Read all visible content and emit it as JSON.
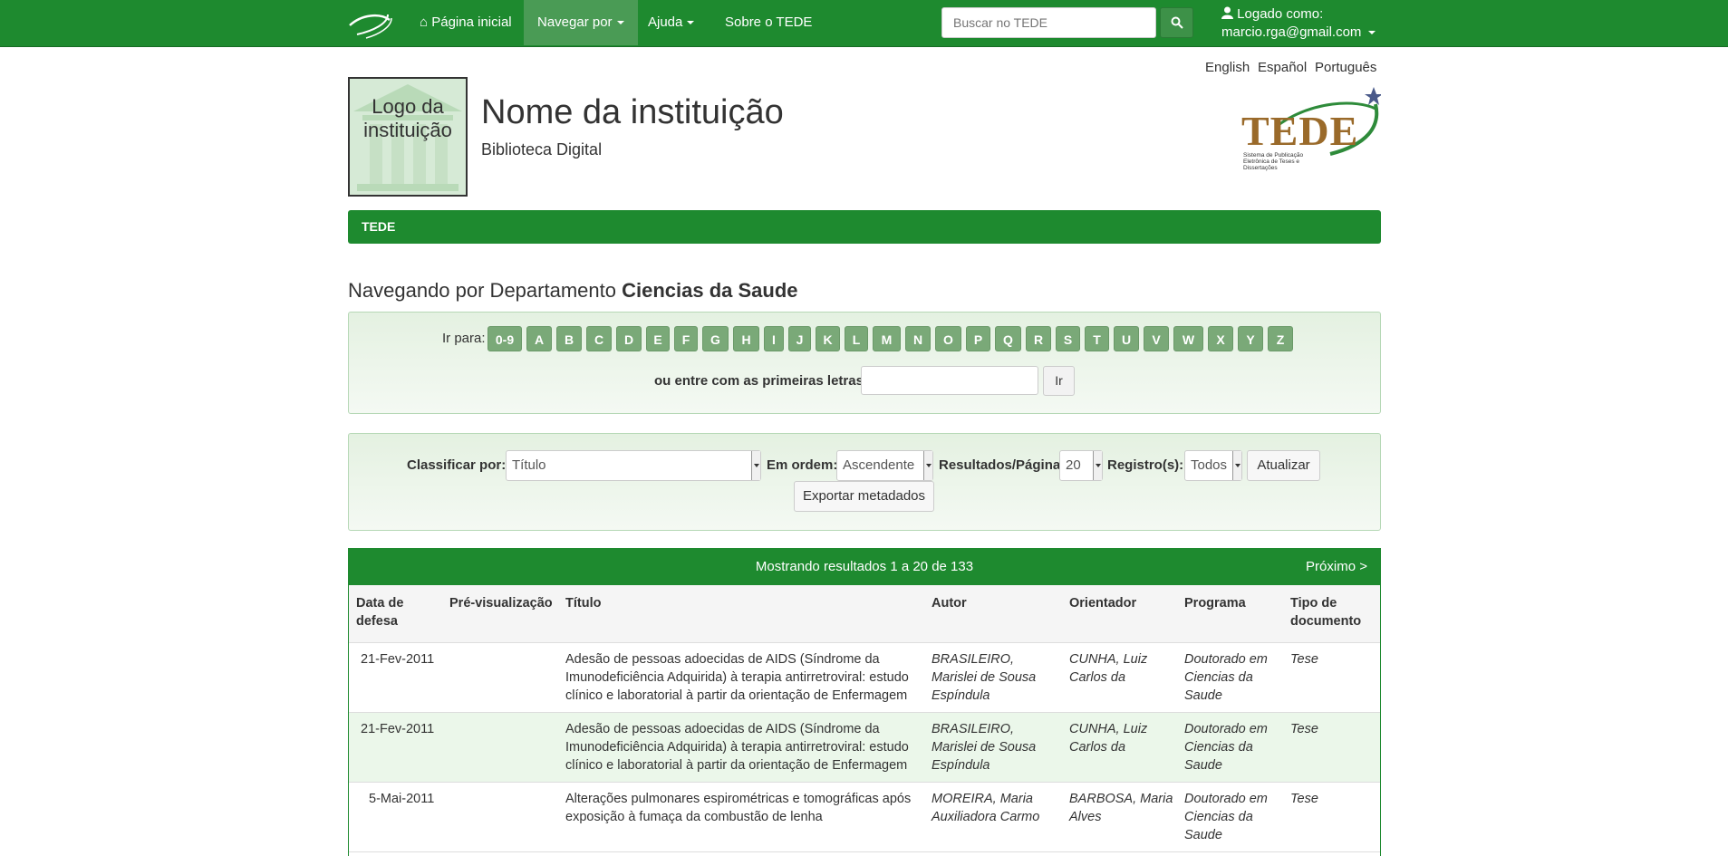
{
  "navbar": {
    "home": "Página inicial",
    "browse": "Navegar por",
    "help": "Ajuda",
    "about": "Sobre o TEDE",
    "search_placeholder": "Buscar no TEDE",
    "logged_as": "Logado como:",
    "user_email": "marcio.rga@gmail.com"
  },
  "languages": [
    "English",
    "Español",
    "Português"
  ],
  "header": {
    "logo_text": "Logo da instituição",
    "institution_name": "Nome da instituição",
    "institution_sub": "Biblioteca Digital",
    "tede_logo_text": "TEDE",
    "tede_logo_sub": "Sistema de Publicação Eletrônica de Teses e Dissertações"
  },
  "breadcrumb": "TEDE",
  "browse": {
    "prefix": "Navegando por Departamento",
    "value": "Ciencias da Saude"
  },
  "jump": {
    "label": "Ir para:",
    "letters": [
      "0-9",
      "A",
      "B",
      "C",
      "D",
      "E",
      "F",
      "G",
      "H",
      "I",
      "J",
      "K",
      "L",
      "M",
      "N",
      "O",
      "P",
      "Q",
      "R",
      "S",
      "T",
      "U",
      "V",
      "W",
      "X",
      "Y",
      "Z"
    ],
    "starts_label": "ou entre com as primeiras letras:",
    "go": "Ir"
  },
  "sort": {
    "sort_by_label": "Classificar por:",
    "sort_by_value": "Título",
    "order_label": "Em ordem:",
    "order_value": "Ascendente",
    "rpp_label": "Resultados/Página",
    "rpp_value": "20",
    "records_label": "Registro(s):",
    "records_value": "Todos",
    "update": "Atualizar",
    "export": "Exportar metadados"
  },
  "results": {
    "showing": "Mostrando resultados 1 a 20 de 133",
    "next": "Próximo >",
    "columns": {
      "date": [
        "Data de",
        "defesa"
      ],
      "preview": "Pré-visualização",
      "title": "Título",
      "author": "Autor",
      "advisor": "Orientador",
      "program": "Programa",
      "type": [
        "Tipo de",
        "documento"
      ]
    },
    "rows": [
      {
        "date": "21-Fev-2011",
        "title": [
          "Adesão de pessoas adoecidas de AIDS (Síndrome da",
          "Imunodeficiência Adquirida) à terapia antirretroviral: estudo",
          "clínico e laboratorial à partir da orientação de Enfermagem"
        ],
        "author": [
          "BRASILEIRO,",
          "Marislei de Sousa",
          "Espíndula"
        ],
        "advisor": [
          "CUNHA, Luiz",
          "Carlos da"
        ],
        "program": [
          "Doutorado em",
          "Ciencias da",
          "Saude"
        ],
        "type": "Tese"
      },
      {
        "date": "21-Fev-2011",
        "title": [
          "Adesão de pessoas adoecidas de AIDS (Síndrome da",
          "Imunodeficiência Adquirida) à terapia antirretroviral: estudo",
          "clínico e laboratorial à partir da orientação de Enfermagem"
        ],
        "author": [
          "BRASILEIRO,",
          "Marislei de Sousa",
          "Espíndula"
        ],
        "advisor": [
          "CUNHA, Luiz",
          "Carlos da"
        ],
        "program": [
          "Doutorado em",
          "Ciencias da",
          "Saude"
        ],
        "type": "Tese"
      },
      {
        "date": "5-Mai-2011",
        "title": [
          "Alterações pulmonares espirométricas e tomográficas após",
          "exposição à fumaça da combustão de lenha"
        ],
        "author": [
          "MOREIRA, Maria",
          "Auxiliadora Carmo"
        ],
        "advisor": [
          "BARBOSA, Maria",
          "Alves"
        ],
        "program": [
          "Doutorado em",
          "Ciencias da",
          "Saude"
        ],
        "type": "Tese"
      }
    ]
  },
  "colors": {
    "primary_green": "#1e8a2f",
    "active_nav": "#4a9b55",
    "letter_button": "#7aa978",
    "row_alt": "#ebf7ea"
  }
}
